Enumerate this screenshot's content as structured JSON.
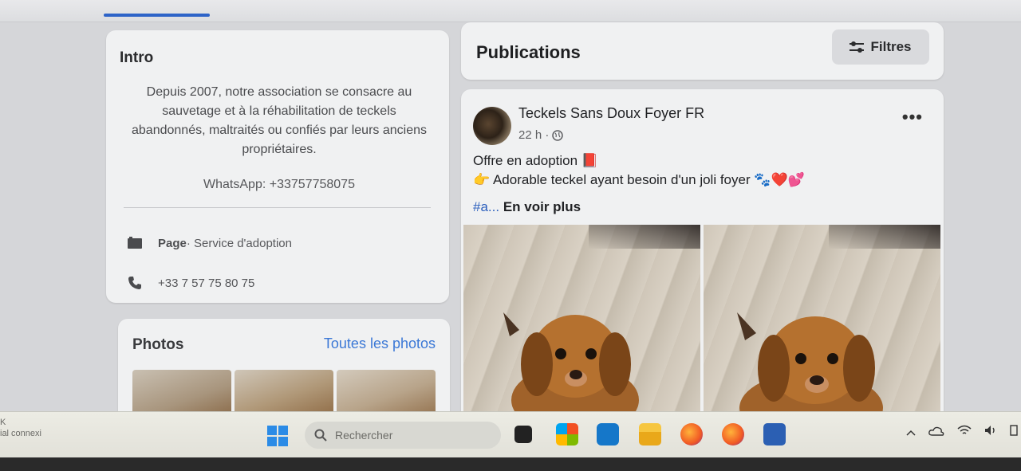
{
  "intro": {
    "title": "Intro",
    "bio": "Depuis 2007, notre association se consacre au sauvetage et à la réhabilitation de teckels abandonnés, maltraités ou confiés par leurs anciens propriétaires.",
    "whatsapp": "WhatsApp: +33757758075",
    "page_label": "Page",
    "page_category": " · Service d'adoption",
    "phone": "+33 7 57 75 80 75"
  },
  "photos": {
    "title": "Photos",
    "link": "Toutes les photos"
  },
  "publications": {
    "title": "Publications",
    "filters_label": "Filtres"
  },
  "post": {
    "author": "Teckels Sans Doux Foyer FR",
    "time": "22 h · ",
    "line1": "Offre en adoption 📕",
    "line2": "👉 Adorable teckel ayant besoin d'un joli foyer 🐾❤️💕",
    "hashtag": "#a...",
    "see_more": " En voir plus",
    "more": "•••"
  },
  "taskbar": {
    "search_placeholder": "Rechercher",
    "left_text_1": "K",
    "left_text_2": "ial connexi"
  },
  "colors": {
    "accent": "#2d63c8",
    "link": "#3b78d6",
    "hashtag": "#2c5fbd"
  }
}
